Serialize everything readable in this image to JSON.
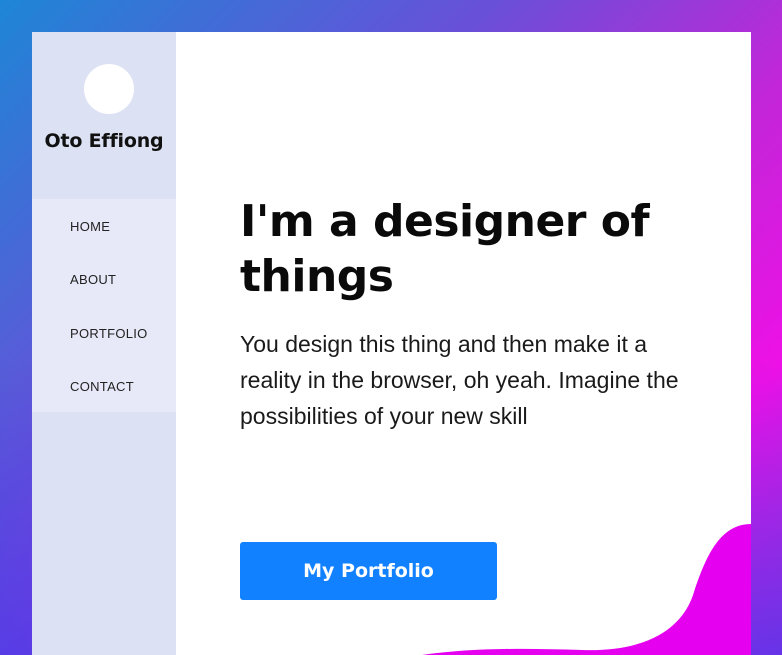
{
  "profile": {
    "name": "Oto Effiong"
  },
  "nav": {
    "items": [
      {
        "label": "HOME"
      },
      {
        "label": "ABOUT"
      },
      {
        "label": "PORTFOLIO"
      },
      {
        "label": "CONTACT"
      }
    ]
  },
  "hero": {
    "headline_line1": "I'm a designer of",
    "headline_line2": "things",
    "subtext": "You design this thing and then make it a reality in the browser, oh yeah. Imagine the possibilities of your new skill",
    "cta_label": "My Portfolio"
  },
  "colors": {
    "accent": "#1181ff",
    "blob": "#e600f0",
    "sidebar": "#dde1f4"
  }
}
